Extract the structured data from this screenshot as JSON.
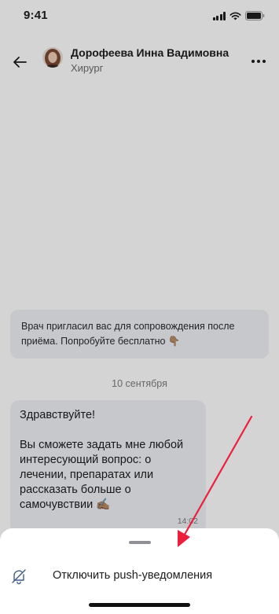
{
  "status_bar": {
    "time": "9:41",
    "icons": [
      "signal-icon",
      "wifi-icon",
      "battery-icon"
    ]
  },
  "header": {
    "back_icon": "arrow-left-icon",
    "name": "Дорофеева Инна Вадимовна",
    "role": "Хирург",
    "more_icon": "more-horizontal-icon"
  },
  "chat": {
    "invite_text": "Врач пригласил вас для сопровождения после приёма. Попробуйте бесплатно 👇🏽",
    "date": "10 сентября",
    "message": {
      "text": "Здравствуйте!\n\nВы сможете задать мне любой интересующий вопрос: о лечении, препаратах или рассказать больше о самочувствии ✍🏽",
      "time": "14:02"
    }
  },
  "sheet": {
    "option_label": "Отключить push-уведомления",
    "option_icon": "bell-off-icon"
  },
  "colors": {
    "bubble_bg": "#eef1f6",
    "overlay": "rgba(0,0,0,0.17)",
    "annotation_arrow": "#ec1f3c"
  }
}
